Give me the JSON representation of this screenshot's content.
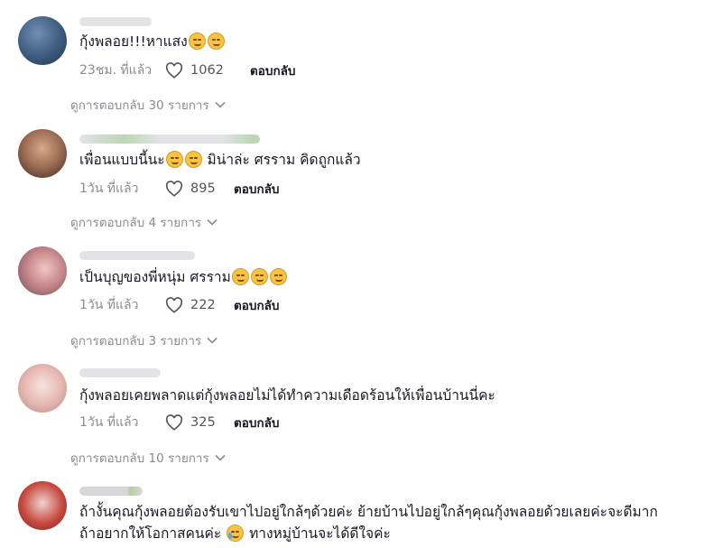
{
  "comments": [
    {
      "text_before": "กุ้งพลอย!!!หาแสง",
      "emojis": [
        "grin-emoji",
        "grin-emoji"
      ],
      "text_after": "",
      "time": "23ชม. ที่แล้ว",
      "likes": "1062",
      "reply_label": "ตอบกลับ",
      "view_replies": "ดูการตอบกลับ 30 รายการ"
    },
    {
      "text_before": "เพื่อนแบบนี้นะ",
      "emojis": [
        "grin-emoji",
        "grin-emoji"
      ],
      "text_after": " มิน่าล่ะ ศรราม คิดถูกแล้ว",
      "time": "1วัน ที่แล้ว",
      "likes": "895",
      "reply_label": "ตอบกลับ",
      "view_replies": "ดูการตอบกลับ 4 รายการ"
    },
    {
      "text_before": "เป็นบุญของพี่หนุ่ม ศรราม",
      "emojis": [
        "relieved-emoji",
        "relieved-emoji",
        "relieved-emoji"
      ],
      "text_after": "",
      "time": "1วัน ที่แล้ว",
      "likes": "222",
      "reply_label": "ตอบกลับ",
      "view_replies": "ดูการตอบกลับ 3 รายการ"
    },
    {
      "text_before": "กุ้งพลอยเคยพลาดแต่กุ้งพลอยไม่ได้ทำความเดือดร้อนให้เพื่อนบ้านนี่คะ",
      "emojis": [],
      "text_after": "",
      "time": "1วัน ที่แล้ว",
      "likes": "325",
      "reply_label": "ตอบกลับ",
      "view_replies": "ดูการตอบกลับ 10 รายการ"
    },
    {
      "line1": "ถ้างั้นคุณกุ้งพลอยต้องรับเขาไปอยู่ใกล้ๆด้วยค่ะ ย้ายบ้านไปอยู่ใกล้ๆคุณกุ้งพลอยด้วยเลยค่ะจะดีมาก",
      "line2_before": "ถ้าอยากให้โอกาสคนค่ะ",
      "line2_after": " ทางหมู่บ้านจะได้ดีใจค่ะ",
      "emoji": "tears-of-joy-emoji"
    }
  ],
  "colors": {
    "text": "#161823",
    "muted": "#8a8b91",
    "emoji": "#f6c343"
  }
}
